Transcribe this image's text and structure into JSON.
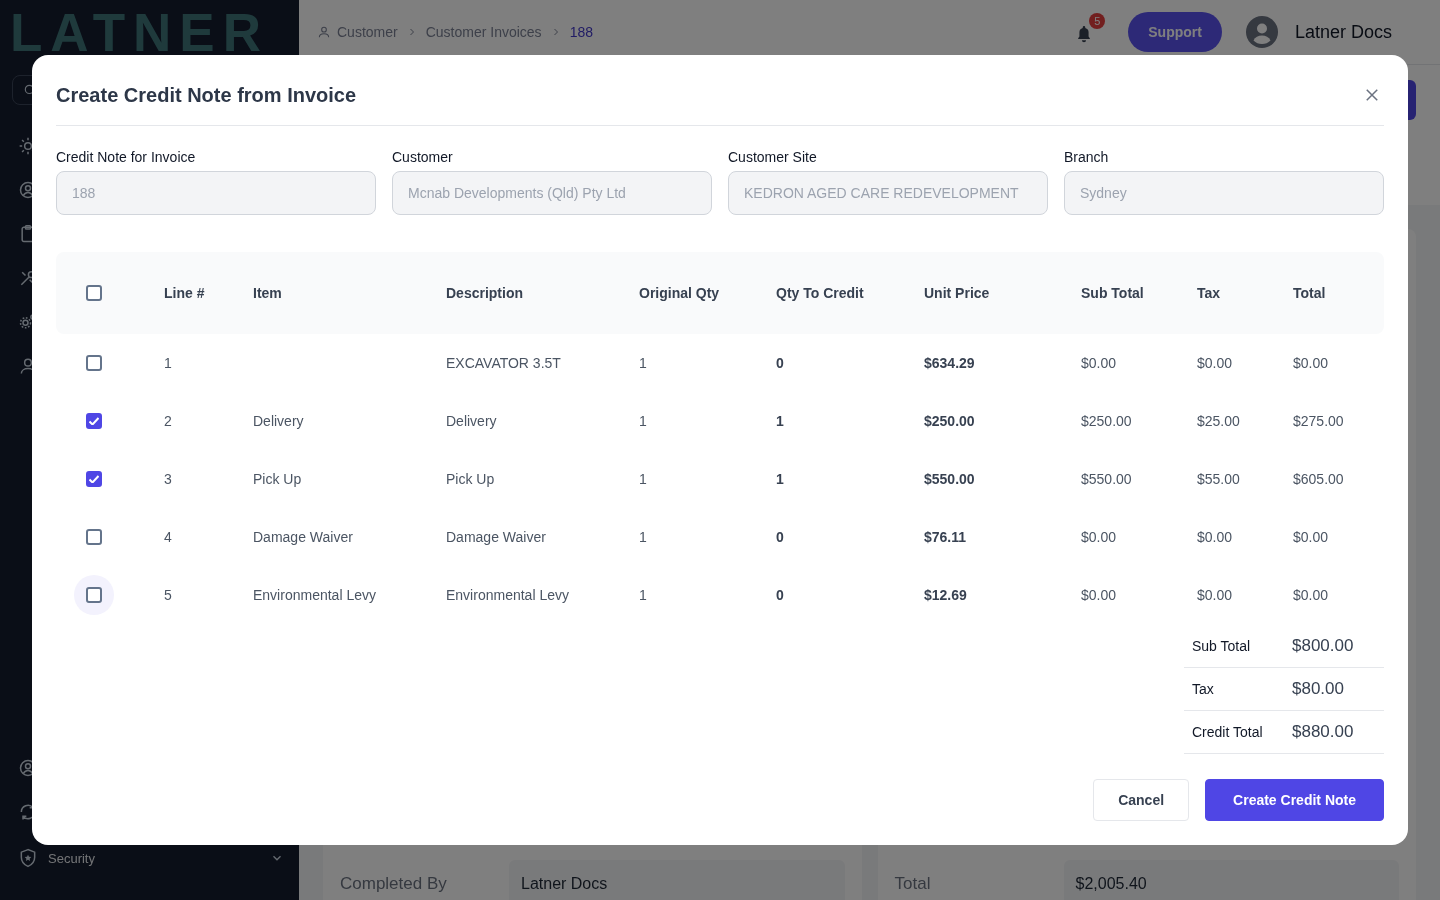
{
  "sidebar": {
    "logo": "LATNER",
    "items": [
      {
        "label": "Security",
        "expanded": false
      }
    ]
  },
  "header": {
    "breadcrumbs": [
      {
        "label": "Customer",
        "current": false
      },
      {
        "label": "Customer Invoices",
        "current": false
      },
      {
        "label": "188",
        "current": true
      }
    ],
    "notification_badge": "5",
    "support_button": "Support",
    "user_name": "Latner Docs"
  },
  "page": {
    "details": [
      {
        "label": "Completed By",
        "value": "Latner Docs"
      },
      {
        "label": "Total",
        "value": "$2,005.40"
      }
    ]
  },
  "modal": {
    "title": "Create Credit Note from Invoice",
    "fields": [
      {
        "label": "Credit Note for Invoice",
        "value": "188",
        "disabled": true
      },
      {
        "label": "Customer",
        "value": "Mcnab Developments (Qld) Pty Ltd",
        "disabled": true
      },
      {
        "label": "Customer Site",
        "value": "KEDRON AGED CARE REDEVELOPMENT",
        "disabled": true
      },
      {
        "label": "Branch",
        "value": "Sydney",
        "disabled": true
      }
    ],
    "table": {
      "select_all_checked": false,
      "columns": [
        "Line #",
        "Item",
        "Description",
        "Original Qty",
        "Qty To Credit",
        "Unit Price",
        "Sub Total",
        "Tax",
        "Total"
      ],
      "rows": [
        {
          "checked": false,
          "hovered": false,
          "line": "1",
          "description": "EXCAVATOR 3.5T",
          "original_qty": "1",
          "qty_to_credit": "0",
          "unit_price": "$634.29",
          "sub_total": "$0.00",
          "tax": "$0.00",
          "total": "$0.00"
        },
        {
          "checked": true,
          "hovered": false,
          "line": "2",
          "item": "Delivery",
          "description": "Delivery",
          "original_qty": "1",
          "qty_to_credit": "1",
          "unit_price": "$250.00",
          "sub_total": "$250.00",
          "tax": "$25.00",
          "total": "$275.00"
        },
        {
          "checked": true,
          "hovered": false,
          "line": "3",
          "item": "Pick Up",
          "description": "Pick Up",
          "original_qty": "1",
          "qty_to_credit": "1",
          "unit_price": "$550.00",
          "sub_total": "$550.00",
          "tax": "$55.00",
          "total": "$605.00"
        },
        {
          "checked": false,
          "hovered": false,
          "line": "4",
          "item": "Damage Waiver",
          "description": "Damage Waiver",
          "original_qty": "1",
          "qty_to_credit": "0",
          "unit_price": "$76.11",
          "sub_total": "$0.00",
          "tax": "$0.00",
          "total": "$0.00"
        },
        {
          "checked": false,
          "hovered": true,
          "line": "5",
          "item": "Environmental Levy",
          "description": "Environmental Levy",
          "original_qty": "1",
          "qty_to_credit": "0",
          "unit_price": "$12.69",
          "sub_total": "$0.00",
          "tax": "$0.00",
          "total": "$0.00"
        }
      ]
    },
    "totals": [
      {
        "label": "Sub Total",
        "value": "$800.00"
      },
      {
        "label": "Tax",
        "value": "$80.00"
      },
      {
        "label": "Credit Total",
        "value": "$880.00"
      }
    ],
    "buttons": [
      {
        "label": "Cancel",
        "kind": "secondary"
      },
      {
        "label": "Create Credit Note",
        "kind": "primary"
      }
    ]
  }
}
